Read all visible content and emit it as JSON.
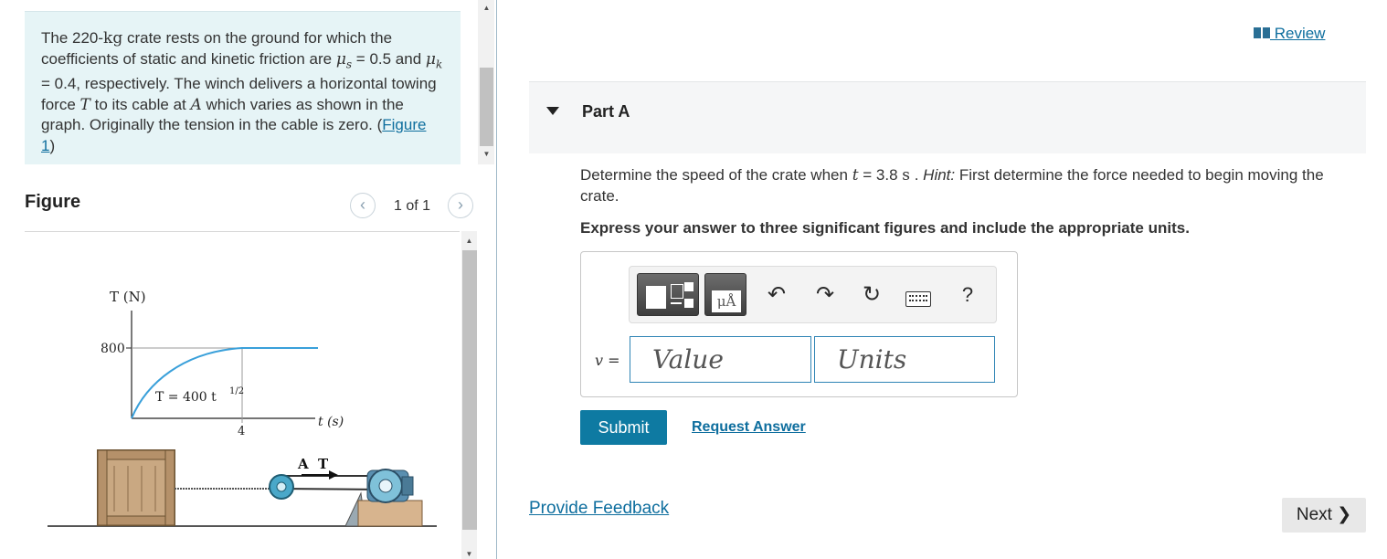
{
  "problem": {
    "text_1": "The 220-",
    "mass_unit": "kg",
    "text_2": " crate rests on the ground for which the coefficients of static and kinetic friction are ",
    "mu_s": "μ",
    "mu_s_sub": "s",
    "text_3": " = 0.5 and ",
    "mu_k": "μ",
    "mu_k_sub": "k",
    "text_4": " = 0.4, respectively. The winch delivers a horizontal towing force ",
    "T": "T",
    "text_5": " to its cable at ",
    "A": "A",
    "text_6": " which varies as shown in the graph. Originally the tension in the cable is zero. (",
    "figure_link": "Figure 1",
    "text_7": ")"
  },
  "figure": {
    "title": "Figure",
    "prev_icon": "chevron-left-icon",
    "next_icon": "chevron-right-icon",
    "count": "1 of 1",
    "graph": {
      "y_label": "T (N)",
      "x_label": "t (s)",
      "y_tick": "800",
      "x_tick": "4",
      "equation": "T = 400 t",
      "equation_exp": "1/2",
      "point_label_A": "A",
      "point_label_T": "T",
      "curve_color": "#3aa0da"
    }
  },
  "review": {
    "icon": "book-icon",
    "label": " Review"
  },
  "part": {
    "title": "Part A",
    "question_1": "Determine the speed of the crate when ",
    "question_t": "t",
    "question_2": " = 3.8 ",
    "question_unit": "s",
    "question_3": " . ",
    "hint_label": "Hint:",
    "question_4": " First determine the force needed to begin moving the crate.",
    "instructions": "Express your answer to three significant figures and include the appropriate units."
  },
  "toolbar": {
    "templates_icon": "templates-icon",
    "units_icon_label": "μÅ",
    "undo_icon": "undo-icon",
    "redo_icon": "redo-icon",
    "reset_icon": "reset-icon",
    "keyboard_icon": "keyboard-icon",
    "help_label": "?"
  },
  "answer": {
    "var_label": "v",
    "equals": " =",
    "value_placeholder": "Value",
    "units_placeholder": "Units"
  },
  "actions": {
    "submit": "Submit",
    "request_answer": "Request Answer",
    "feedback": "Provide Feedback",
    "next": "Next"
  },
  "colors": {
    "accent": "#0e7aa2",
    "link": "#0e6e9e",
    "problem_bg": "#e6f4f6",
    "field_border": "#2f84b5"
  }
}
